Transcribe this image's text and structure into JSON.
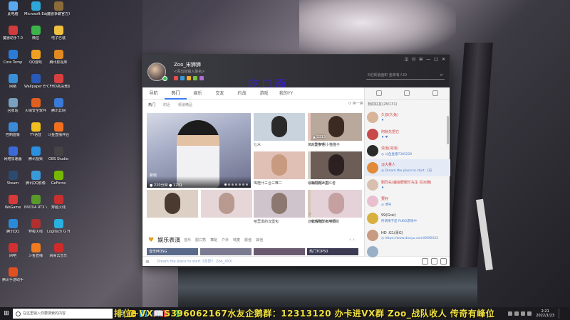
{
  "desktop": {
    "icons": [
      {
        "label": "此电脑",
        "color": "#5aa9f0"
      },
      {
        "label": "Microsoft Edge",
        "color": "#2fa6d9"
      },
      {
        "label": "魔兽争霸官方对战平台",
        "color": "#8a6b3a"
      },
      {
        "label": "魔兽助手7.0",
        "color": "#d23b3b"
      },
      {
        "label": "微信",
        "color": "#3bb54a"
      },
      {
        "label": "电子已装",
        "color": "#f0c040"
      },
      {
        "label": "Core Temp",
        "color": "#2a7ad8"
      },
      {
        "label": "QQ游戏",
        "color": "#f0a020"
      },
      {
        "label": "腾讯影视库",
        "color": "#e08a20"
      },
      {
        "label": "网络",
        "color": "#3a90d8"
      },
      {
        "label": "Wallpaper Engine",
        "color": "#2a5ab8"
      },
      {
        "label": "CFHD高清竞技大区",
        "color": "#d84040"
      },
      {
        "label": "回收站",
        "color": "#7aa0c0"
      },
      {
        "label": "火绒安全软件",
        "color": "#e06020"
      },
      {
        "label": "腾讯云网",
        "color": "#3a7ad8"
      },
      {
        "label": "控制面板",
        "color": "#3a8ad8"
      },
      {
        "label": "YY语音",
        "color": "#f0c020"
      },
      {
        "label": "斗鱼直播伴侣",
        "color": "#f07020"
      },
      {
        "label": "网络加速器",
        "color": "#3a6ad8"
      },
      {
        "label": "腾讯视频",
        "color": "#2a90e0"
      },
      {
        "label": "OBS Studio",
        "color": "#444444"
      },
      {
        "label": "Steam",
        "color": "#2a4a70"
      },
      {
        "label": "腾讯QQ影像",
        "color": "#3a9ad8"
      },
      {
        "label": "GeForce",
        "color": "#76b900"
      },
      {
        "label": "WeGame",
        "color": "#d83a3a"
      },
      {
        "label": "NVIDIA RTX Voice",
        "color": "#5a9a2a"
      },
      {
        "label": "穿越火线",
        "color": "#c83030"
      },
      {
        "label": "腾讯QQ",
        "color": "#2a8ad8"
      },
      {
        "label": "穿梭火线",
        "color": "#b03030"
      },
      {
        "label": "Logitech G HUB",
        "color": "#2ab0e0"
      },
      {
        "label": "网吧",
        "color": "#d03030"
      },
      {
        "label": "斗鱼直播",
        "color": "#f07a20"
      },
      {
        "label": "网易云音乐",
        "color": "#d02a2a"
      },
      {
        "label": "腾讯手游助手",
        "color": "#e05020"
      }
    ]
  },
  "window": {
    "user_name": "Zoo_宋狮狮",
    "user_sign": "<青出处输入签名>",
    "search_placeholder": "5伦频道面积    金库有人ID",
    "search_arrow": "↵",
    "overlay_title": "吃口面",
    "controls": [
      "◫",
      "⊡",
      "⊞",
      "—",
      "□",
      "✕"
    ],
    "nav_tabs": [
      "导航",
      "热门",
      "娱乐",
      "交友",
      "约战",
      "游戏",
      "我的YY"
    ],
    "active_nav": "热门",
    "sub_tabs": [
      "热门",
      "附近",
      "频道精品"
    ],
    "refresh_label": "⟳ 换一换",
    "hero": {
      "tag": "新晓",
      "viewers": "● 220分钟   ● 1231"
    },
    "thumbs": [
      {
        "label": "七木",
        "viewers": "",
        "bg": "#c9d3dd",
        "face": "#2a2a2a"
      },
      {
        "label": "黄片到梦想小猫猫子",
        "viewers": "",
        "bg": "#e8c7c2",
        "face": "#d8b090"
      },
      {
        "label": "三里半手",
        "viewers": "▲ 2313",
        "bg": "#b9a89c",
        "face": "#3a2a22"
      },
      {
        "label": "喝橙汁三合三唯二",
        "viewers": "",
        "bg": "#e0c0b4",
        "face": "#c89a80"
      },
      {
        "label": "最新情报出现",
        "viewers": "",
        "bg": "#d4d0c8",
        "face": "#caa88c"
      },
      {
        "label": "海的刺人主义者",
        "viewers": "",
        "bg": "#6c5d56",
        "face": "#2c2020"
      },
      {
        "label": "哈里发的汉堡包",
        "viewers": "",
        "bg": "#cfc4cc",
        "face": "#8c7870"
      },
      {
        "label": "还记得踏下石神月",
        "viewers": "▲ 124010",
        "bg": "#d8c8b8",
        "face": "#6a5040"
      },
      {
        "label": "难忘怀影片与爱欲",
        "viewers": "",
        "bg": "#e4d2d8",
        "face": "#c4a0a0"
      }
    ],
    "section": {
      "title": "娱乐表演",
      "sub_tabs": [
        "音乐",
        "脱口秀",
        "舞蹈",
        "户外",
        "喊麦",
        "颜值",
        "其他"
      ],
      "arrows": "‹  ›",
      "strips": [
        "音乐MOSG",
        "",
        "",
        "热门TOP50"
      ]
    },
    "footer": {
      "menu_icon": "≡",
      "chat_placeholder": "Dream the place to start《向梦》 Zoo_XXX"
    },
    "right_panel": {
      "online_count": "我的好友(28/131)",
      "items": [
        {
          "name": "久叔(久兔)",
          "sub": "♦",
          "av": "#d9b49a",
          "red": true,
          "hl": false
        },
        {
          "name": "阿默先把它",
          "sub": "♦ ♥",
          "av": "#c84a4a",
          "red": true,
          "hl": false
        },
        {
          "name": "清泡(清泡)",
          "sub": "◎ 斗鱼直播7305220",
          "av": "#2a2a2a",
          "red": true,
          "hl": false
        },
        {
          "name": "淡大量人",
          "sub": "◎ Dream the place to start 《向",
          "av": "#e08a3a",
          "red": true,
          "hl": true
        },
        {
          "name": "剧烈先(魔窗肥眼忙先生 且冰酬)",
          "sub": "♦",
          "av": "#d8c0b0",
          "red": true,
          "hl": false
        },
        {
          "name": "要好",
          "sub": "◎ 傅导",
          "av": "#e8c0d0",
          "red": true,
          "hl": false
        },
        {
          "name": "99(Grai)",
          "sub": "所谓果子是   PUBG游戏中",
          "av": "#d8b040",
          "red": false,
          "hl": false
        },
        {
          "name": "HD :G1(哥G)",
          "sub": "◎ https://www.douyu.com/6092022",
          "av": "#c89a80",
          "red": false,
          "hl": false
        },
        {
          "name": "",
          "sub": "",
          "av": "#9ab0c8",
          "red": false,
          "hl": false
        }
      ]
    }
  },
  "taskbar": {
    "search_placeholder": "在这里输入你要搜索的内容",
    "banner": "排位+VX📖S396062167水友企鹅群：12313120  办卡进VX群 Zoo_战队收人 传奇有峰位",
    "time": "2:21",
    "date": "2022/1/23",
    "apps": [
      "#3a7ad8",
      "#e0c020",
      "#3aa0e0",
      "#2a4a70",
      "#e04040",
      "#3bb54a"
    ]
  }
}
